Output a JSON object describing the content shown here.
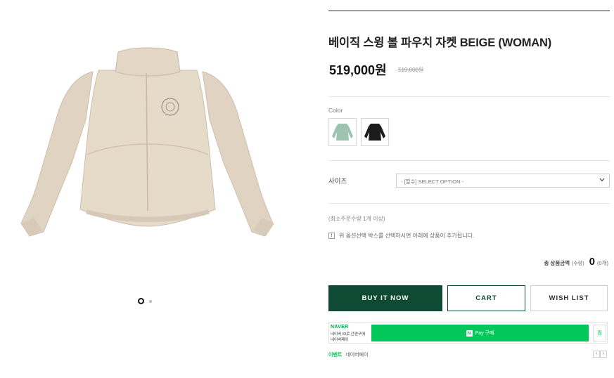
{
  "product": {
    "title": "베이직 스윙 볼 파우치 자켓 BEIGE (WOMAN)",
    "price": "519,000원",
    "original_price": "519,000원"
  },
  "gallery": {
    "slide_count": 2,
    "active_index": 0
  },
  "options": {
    "color_label": "Color",
    "colors": [
      {
        "name": "mint",
        "hex": "#9ec3b0"
      },
      {
        "name": "black",
        "hex": "#1c1c1c"
      }
    ],
    "size_label": "사이즈",
    "size_placeholder": "- [필수] SELECT OPTION -"
  },
  "order_info": {
    "min_qty": "(최소주문수량 1개 이상)",
    "notice": "위 옵션선택 박스를 선택하시면 아래에 상품이 추가됩니다.",
    "notice_icon": "!"
  },
  "total": {
    "label": "총 상품금액",
    "sub": "(수량)",
    "value": "0",
    "count": "(0개)"
  },
  "buttons": {
    "buy": "BUY IT NOW",
    "cart": "CART",
    "wish": "WISH LIST"
  },
  "naver": {
    "logo": "NAVER",
    "line1": "네이버 ID로 간편구매",
    "line2": "네이버페이",
    "pay_n": "N",
    "pay_label": "Pay 구매",
    "wish_label": "찜",
    "event_tag": "이벤트",
    "event_text": "네이버페이",
    "prev": "‹",
    "next": "›"
  },
  "colors": {
    "primary": "#0f4a34",
    "naver_green": "#03c75a",
    "jacket_beige": "#e3d6c6"
  }
}
